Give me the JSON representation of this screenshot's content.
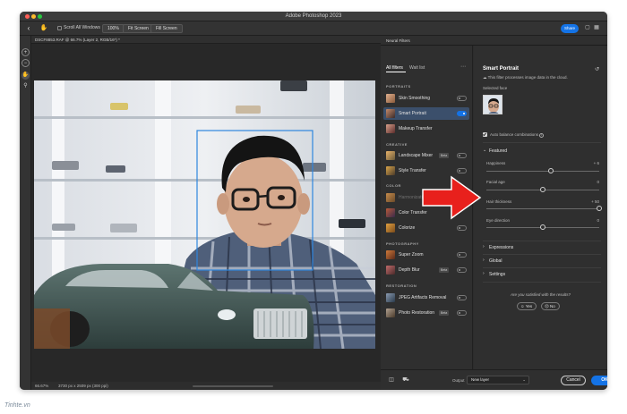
{
  "window": {
    "title": "Adobe Photoshop 2023"
  },
  "options_bar": {
    "scroll_all_windows": "Scroll All Windows",
    "zoom_100": "100%",
    "fit_screen": "Fit Screen",
    "fill_screen": "Fill Screen",
    "share": "Share"
  },
  "document": {
    "tab_title": "DSCF8853.RAF @ 66.7% (Layer 2, RGB/16*) *",
    "status_zoom": "66.67%",
    "status_info": "3730 px x 2509 px (300 ppi)"
  },
  "neural_filters": {
    "panel_title": "Neural Filters",
    "tabs": [
      {
        "label": "All filters"
      },
      {
        "label": "Wait list"
      }
    ],
    "sections": [
      {
        "label": "PORTRAITS"
      },
      {
        "label": "CREATIVE"
      },
      {
        "label": "COLOR"
      },
      {
        "label": "PHOTOGRAPHY"
      },
      {
        "label": "RESTORATION"
      }
    ],
    "filters": [
      {
        "label": "Skin Smoothing"
      },
      {
        "label": "Smart Portrait"
      },
      {
        "label": "Makeup Transfer"
      },
      {
        "label": "Landscape Mixer",
        "badge": "Beta"
      },
      {
        "label": "Style Transfer"
      },
      {
        "label": "Harmonization",
        "badge": "Beta"
      },
      {
        "label": "Color Transfer"
      },
      {
        "label": "Colorize"
      },
      {
        "label": "Super Zoom"
      },
      {
        "label": "Depth Blur",
        "badge": "Beta"
      },
      {
        "label": "JPEG Artifacts Removal"
      },
      {
        "label": "Photo Restoration",
        "badge": "Beta"
      }
    ],
    "selected_filter": "Smart Portrait",
    "smart_portrait_enabled": true
  },
  "settings": {
    "title": "Smart Portrait",
    "cloud_note": "This filter processes image data in the cloud.",
    "selected_face_label": "Selected face",
    "auto_balance_label": "Auto balance combinations",
    "auto_balance_checked": true,
    "featured_label": "Featured",
    "sliders": [
      {
        "label": "Happiness",
        "value": "+ 6",
        "level": 0.57
      },
      {
        "label": "Facial age",
        "value": "0",
        "level": 0.5
      },
      {
        "label": "Hair thickness",
        "value": "+ 50",
        "level": 1.0
      },
      {
        "label": "Eye direction",
        "value": "0",
        "level": 0.5
      }
    ],
    "collapsed_sections": [
      {
        "label": "Expressions"
      },
      {
        "label": "Global"
      },
      {
        "label": "Settings"
      }
    ],
    "satisfied_question": "Are you satisfied with the results?",
    "yes_label": "Yes",
    "no_label": "No"
  },
  "bottom_bar": {
    "output_label": "Output",
    "output_value": "New layer",
    "cancel_label": "Cancel",
    "ok_label": "OK"
  },
  "watermark": "Tinhte.vn",
  "colors": {
    "accent": "#1473e6",
    "panel": "#2f2f2f",
    "selection": "#3b4f6b",
    "arrow": "#e8201c",
    "face_box": "#2e86de"
  }
}
